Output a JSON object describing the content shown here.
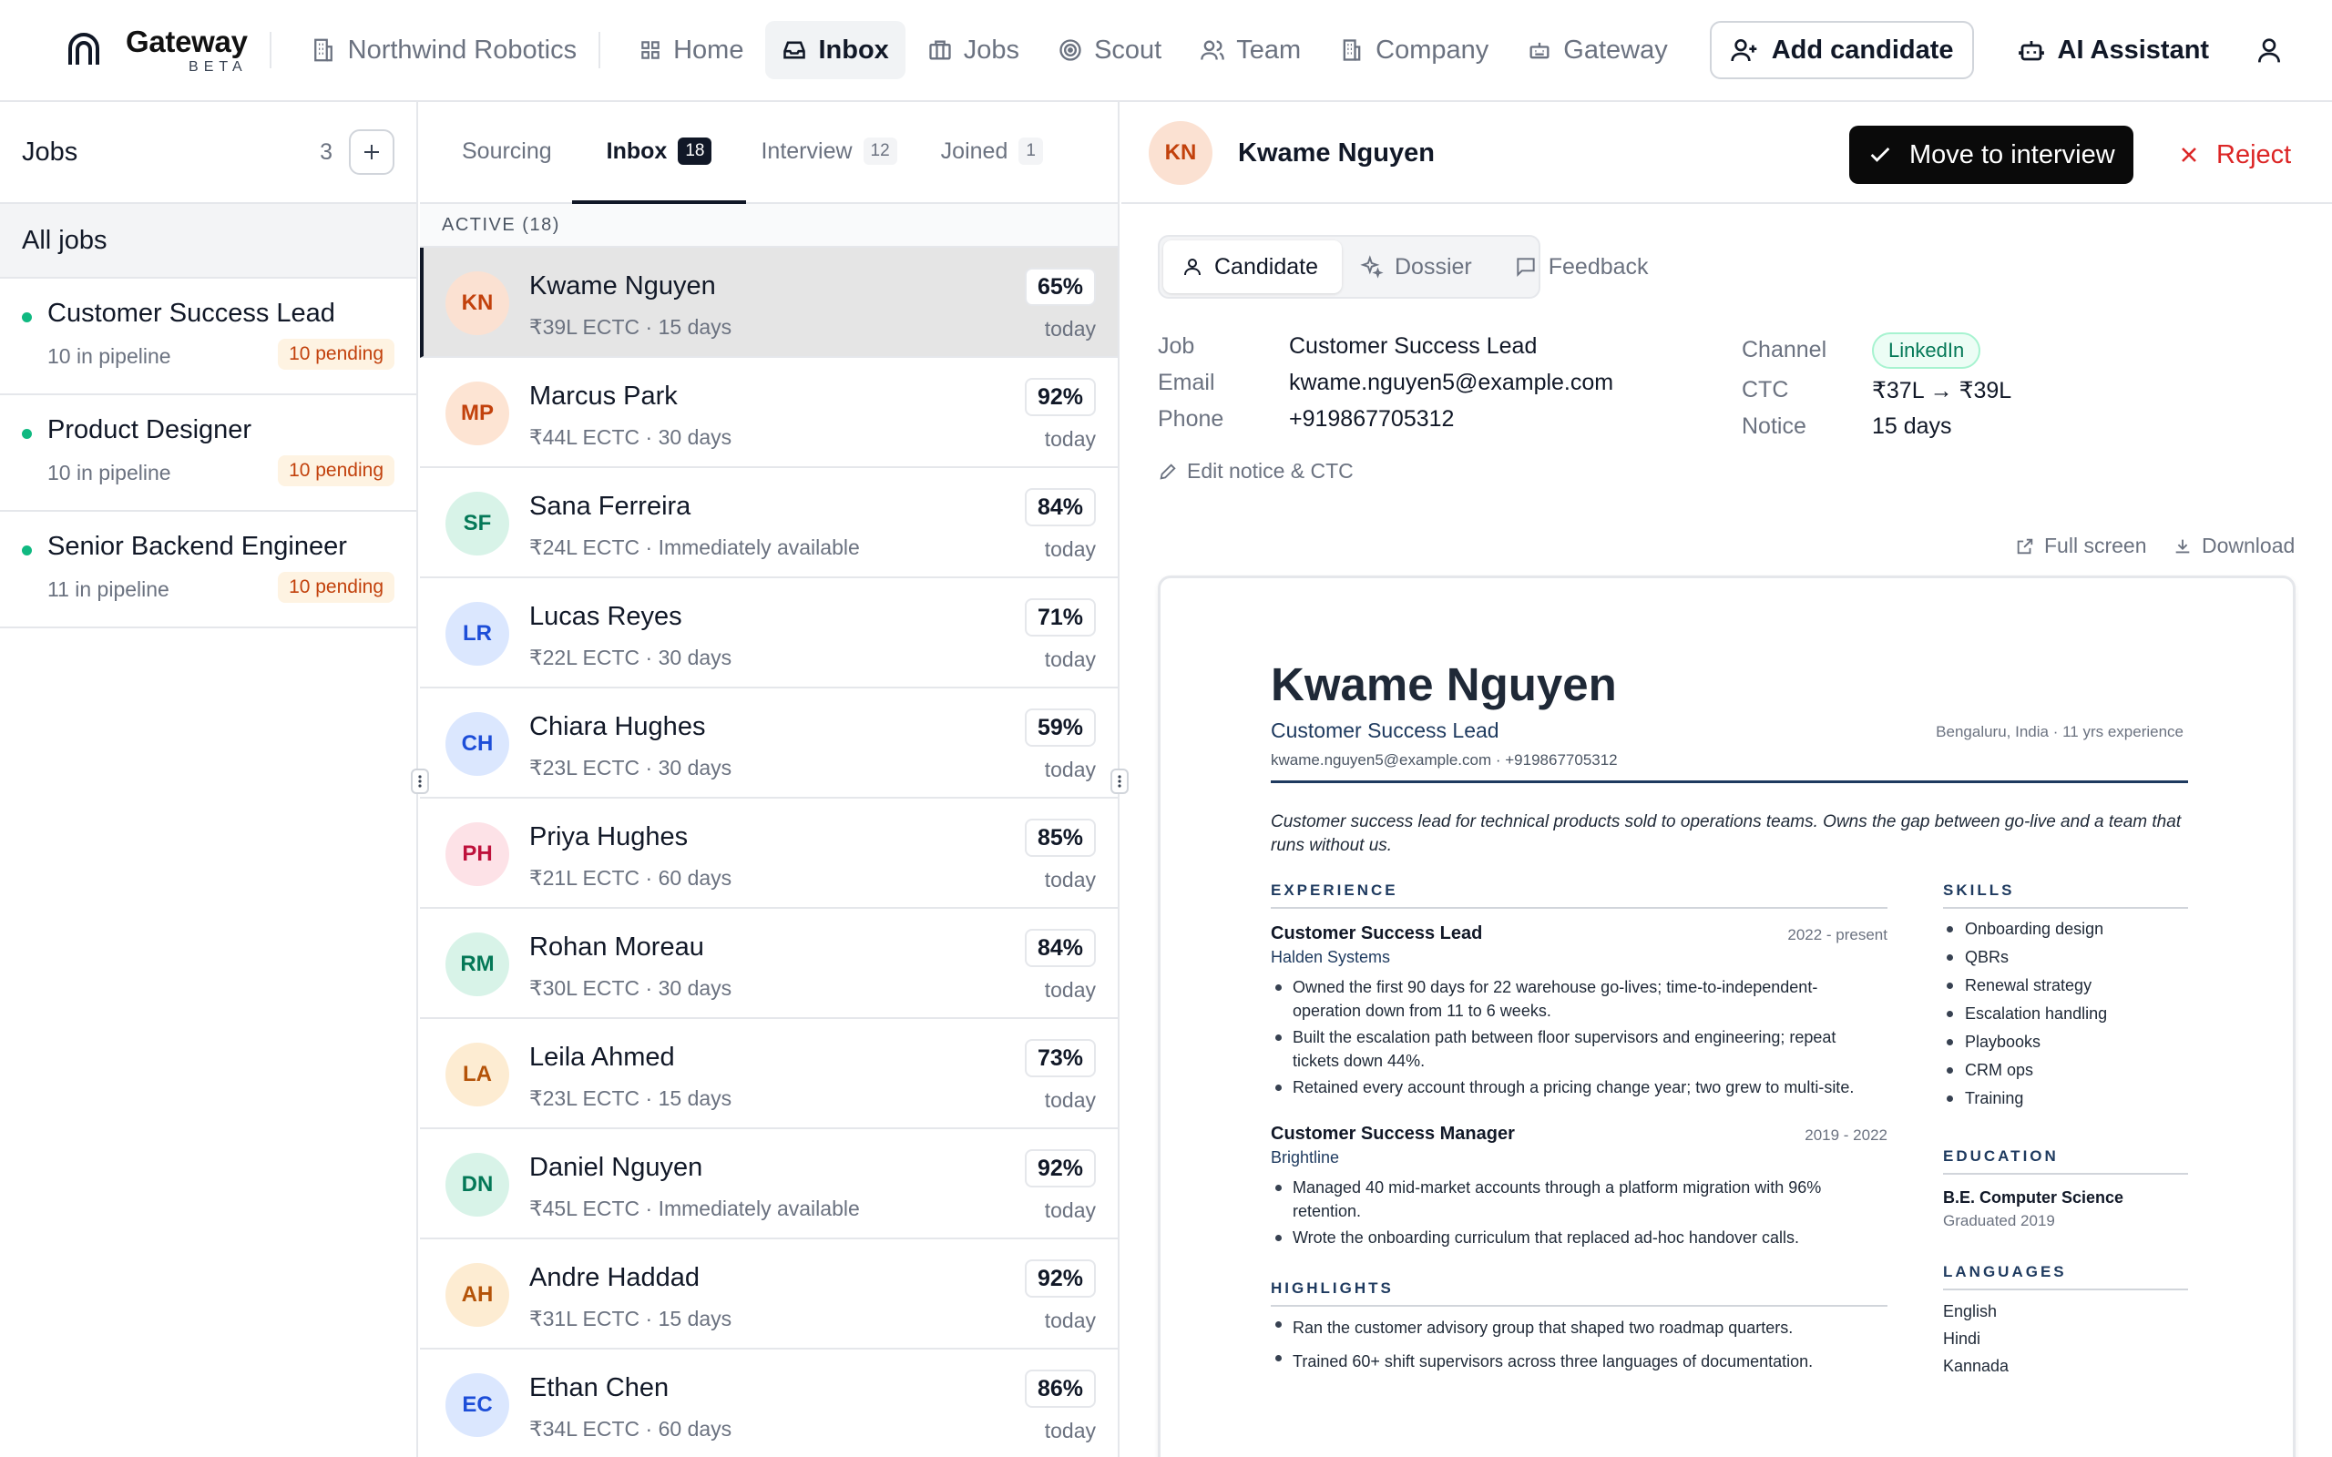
{
  "brand": {
    "name": "Gateway",
    "badge": "BETA",
    "org": "Northwind Robotics"
  },
  "nav": {
    "items": [
      {
        "label": "Home",
        "icon": "grid-icon"
      },
      {
        "label": "Inbox",
        "icon": "inbox-icon",
        "active": true
      },
      {
        "label": "Jobs",
        "icon": "briefcase-icon"
      },
      {
        "label": "Scout",
        "icon": "scout-target-icon"
      },
      {
        "label": "Team",
        "icon": "users-icon"
      },
      {
        "label": "Company",
        "icon": "building-icon"
      },
      {
        "label": "Gateway",
        "icon": "gateway-icon"
      }
    ],
    "add_candidate": "Add candidate",
    "ai_assistant": "AI Assistant"
  },
  "jobs_panel": {
    "title": "Jobs",
    "count": "3",
    "all_jobs": "All jobs",
    "jobs": [
      {
        "name": "Customer Success Lead",
        "pipeline": "10 in pipeline",
        "pending": "10 pending"
      },
      {
        "name": "Product Designer",
        "pipeline": "10 in pipeline",
        "pending": "10 pending"
      },
      {
        "name": "Senior Backend Engineer",
        "pipeline": "11 in pipeline",
        "pending": "10 pending"
      }
    ]
  },
  "inbox_panel": {
    "tabs": [
      {
        "label": "Sourcing",
        "count": ""
      },
      {
        "label": "Inbox",
        "count": "18",
        "active": true
      },
      {
        "label": "Interview",
        "count": "12"
      },
      {
        "label": "Joined",
        "count": "1"
      }
    ],
    "section": "ACTIVE  (18)",
    "candidates": [
      {
        "initials": "KN",
        "name": "Kwame Nguyen",
        "meta": "₹39L ECTC · 15 days",
        "score": "65%",
        "when": "today",
        "bg": "#fbe1d2",
        "fg": "#c2410c",
        "selected": true
      },
      {
        "initials": "MP",
        "name": "Marcus Park",
        "meta": "₹44L ECTC · 30 days",
        "score": "92%",
        "when": "today",
        "bg": "#fde4d3",
        "fg": "#c2410c"
      },
      {
        "initials": "SF",
        "name": "Sana Ferreira",
        "meta": "₹24L ECTC · Immediately available",
        "score": "84%",
        "when": "today",
        "bg": "#d8f3e8",
        "fg": "#047857"
      },
      {
        "initials": "LR",
        "name": "Lucas Reyes",
        "meta": "₹22L ECTC · 30 days",
        "score": "71%",
        "when": "today",
        "bg": "#dbe7fe",
        "fg": "#1d4ed8"
      },
      {
        "initials": "CH",
        "name": "Chiara Hughes",
        "meta": "₹23L ECTC · 30 days",
        "score": "59%",
        "when": "today",
        "bg": "#dbe7fe",
        "fg": "#1d4ed8"
      },
      {
        "initials": "PH",
        "name": "Priya Hughes",
        "meta": "₹21L ECTC · 60 days",
        "score": "85%",
        "when": "today",
        "bg": "#fde2e7",
        "fg": "#be123c"
      },
      {
        "initials": "RM",
        "name": "Rohan Moreau",
        "meta": "₹30L ECTC · 30 days",
        "score": "84%",
        "when": "today",
        "bg": "#d8f3e8",
        "fg": "#047857"
      },
      {
        "initials": "LA",
        "name": "Leila Ahmed",
        "meta": "₹23L ECTC · 15 days",
        "score": "73%",
        "when": "today",
        "bg": "#fdecd2",
        "fg": "#b45309"
      },
      {
        "initials": "DN",
        "name": "Daniel Nguyen",
        "meta": "₹45L ECTC · Immediately available",
        "score": "92%",
        "when": "today",
        "bg": "#d8f3e8",
        "fg": "#047857"
      },
      {
        "initials": "AH",
        "name": "Andre Haddad",
        "meta": "₹31L ECTC · 15 days",
        "score": "92%",
        "when": "today",
        "bg": "#fdecd2",
        "fg": "#b45309"
      },
      {
        "initials": "EC",
        "name": "Ethan Chen",
        "meta": "₹34L ECTC · 60 days",
        "score": "86%",
        "when": "today",
        "bg": "#dbe7fe",
        "fg": "#1d4ed8"
      }
    ]
  },
  "detail": {
    "initials": "KN",
    "name": "Kwame Nguyen",
    "move_label": "Move to interview",
    "reject_label": "Reject",
    "segments": [
      {
        "label": "Candidate",
        "icon": "user-icon",
        "active": true
      },
      {
        "label": "Dossier",
        "icon": "sparkles-icon"
      },
      {
        "label": "Feedback",
        "icon": "message-icon"
      }
    ],
    "fields": {
      "job_label": "Job",
      "job": "Customer Success Lead",
      "email_label": "Email",
      "email": "kwame.nguyen5@example.com",
      "phone_label": "Phone",
      "phone": "+919867705312",
      "channel_label": "Channel",
      "channel": "LinkedIn",
      "ctc_label": "CTC",
      "ctc": "₹37L → ₹39L",
      "notice_label": "Notice",
      "notice": "15 days"
    },
    "edit_label": "Edit notice & CTC",
    "full_screen": "Full screen",
    "download": "Download"
  },
  "resume": {
    "name": "Kwame Nguyen",
    "role": "Customer Success Lead",
    "location": "Bengaluru, India  ·  11 yrs experience",
    "contact": "kwame.nguyen5@example.com   ·   +919867705312",
    "summary": "Customer success lead for technical products sold to operations teams. Owns the gap between go-live and a team that runs without us.",
    "experience_title": "EXPERIENCE",
    "jobs": [
      {
        "title": "Customer Success Lead",
        "dates": "2022 - present",
        "company": "Halden Systems",
        "bullets": [
          "Owned the first 90 days for 22 warehouse go-lives; time-to-independent-operation down from 11 to 6 weeks.",
          "Built the escalation path between floor supervisors and engineering; repeat tickets down 44%.",
          "Retained every account through a pricing change year; two grew to multi-site."
        ]
      },
      {
        "title": "Customer Success Manager",
        "dates": "2019 - 2022",
        "company": "Brightline",
        "bullets": [
          "Managed 40 mid-market accounts through a platform migration with 96% retention.",
          "Wrote the onboarding curriculum that replaced ad-hoc handover calls."
        ]
      }
    ],
    "highlights_title": "HIGHLIGHTS",
    "highlights": [
      "Ran the customer advisory group that shaped two roadmap quarters.",
      "Trained 60+ shift supervisors across three languages of documentation."
    ],
    "skills_title": "SKILLS",
    "skills": [
      "Onboarding design",
      "QBRs",
      "Renewal strategy",
      "Escalation handling",
      "Playbooks",
      "CRM ops",
      "Training"
    ],
    "education_title": "EDUCATION",
    "degree": "B.E. Computer Science",
    "graduated": "Graduated 2019",
    "languages_title": "LANGUAGES",
    "languages": [
      "English",
      "Hindi",
      "Kannada"
    ]
  },
  "colors": {
    "accent_dark": "#0a0a0a",
    "reject": "#dc2626",
    "online_dot": "#10b981",
    "pending_bg": "#fef3e2",
    "pending_fg": "#c2410c"
  }
}
